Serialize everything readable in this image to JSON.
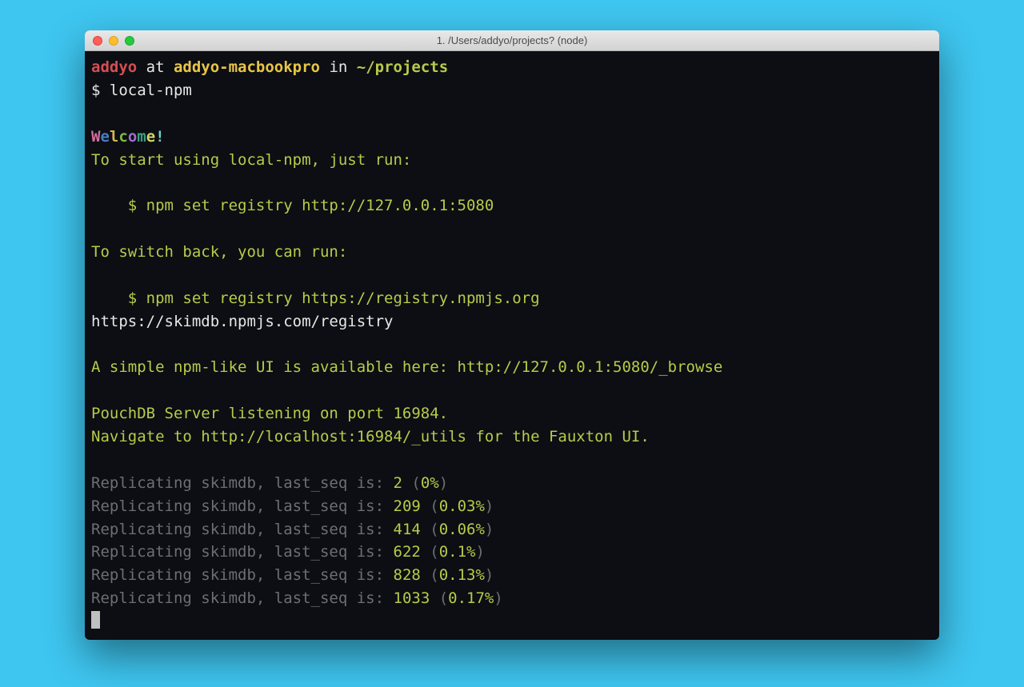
{
  "window": {
    "title": "1. /Users/addyo/projects? (node)"
  },
  "prompt": {
    "user": "addyo",
    "at": " at ",
    "host": "addyo-macbookpro",
    "in": " in ",
    "path": "~/projects",
    "symbol": "$ ",
    "command": "local-npm"
  },
  "welcome": [
    "W",
    "e",
    "l",
    "c",
    "o",
    "m",
    "e",
    "!"
  ],
  "lines": {
    "start_hint": "To start using local-npm, just run:",
    "set_registry": "    $ npm set registry http://127.0.0.1:5080",
    "switch_back": "To switch back, you can run:",
    "set_registry_back": "    $ npm set registry https://registry.npmjs.org",
    "skimdb_url": "https://skimdb.npmjs.com/registry",
    "ui_hint": "A simple npm-like UI is available here: http://127.0.0.1:5080/_browse",
    "pouchdb": "PouchDB Server listening on port 16984.",
    "fauxton": "Navigate to http://localhost:16984/_utils for the Fauxton UI."
  },
  "replication_prefix": "Replicating skimdb, last_seq is: ",
  "replication": [
    {
      "seq": "2",
      "pct": "0%"
    },
    {
      "seq": "209",
      "pct": "0.03%"
    },
    {
      "seq": "414",
      "pct": "0.06%"
    },
    {
      "seq": "622",
      "pct": "0.1%"
    },
    {
      "seq": "828",
      "pct": "0.13%"
    },
    {
      "seq": "1033",
      "pct": "0.17%"
    }
  ]
}
